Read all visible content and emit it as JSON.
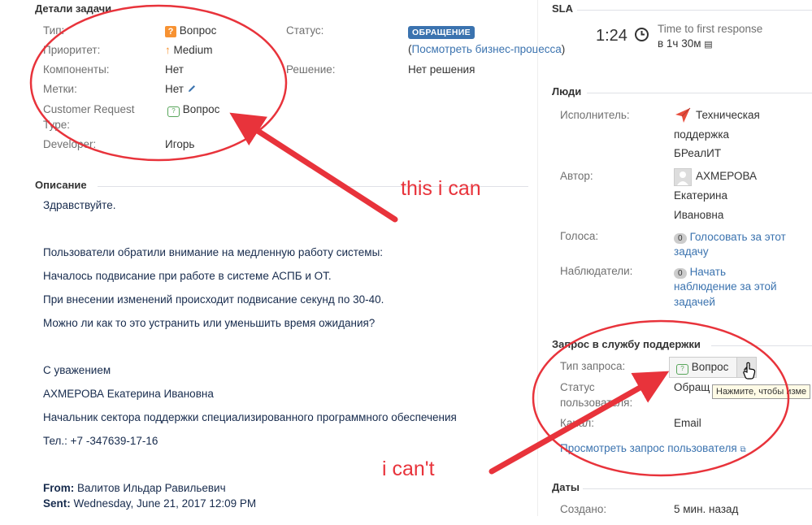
{
  "details": {
    "title": "Детали задачи",
    "type_label": "Тип:",
    "type_value": "Вопрос",
    "priority_label": "Приоритет:",
    "priority_value": "Medium",
    "components_label": "Компоненты:",
    "components_value": "Нет",
    "labels_label": "Метки:",
    "labels_value": "Нет",
    "crt_label_1": "Customer Request",
    "crt_label_2": "Type:",
    "crt_value": "Вопрос",
    "developer_label": "Developer:",
    "developer_value": "Игорь",
    "status_label": "Статус:",
    "status_value": "ОБРАЩЕНИЕ",
    "workflow_open": "(",
    "workflow_link": "Посмотреть бизнес-процесса",
    "workflow_close": ")",
    "resolution_label": "Решение:",
    "resolution_value": "Нет решения"
  },
  "description": {
    "title": "Описание",
    "lines": [
      "Здравствуйте.",
      "Пользователи обратили внимание на медленную работу системы:",
      "Началось подвисание при работе в системе АСПБ и ОТ.",
      "При внесении изменений происходит подвисание секунд по 30-40.",
      "Можно ли как то это устранить или уменьшить время ожидания?",
      "С уважением",
      "АХМЕРОВА Екатерина Ивановна",
      "Начальник сектора поддержки специализированного программного обеспечения",
      "Тел.: +7 -347639-17-16"
    ],
    "from_label": "From:",
    "from_value": "Валитов Ильдар Равильевич",
    "sent_label": "Sent:",
    "sent_value": "Wednesday, June 21, 2017 12:09 PM"
  },
  "sla": {
    "title": "SLA",
    "time": "1:24",
    "metric": "Time to first response",
    "target": "в 1ч 30м"
  },
  "people": {
    "title": "Люди",
    "assignee_label": "Исполнитель:",
    "assignee_lines": [
      "Техническая",
      "поддержка",
      "БРеалИТ"
    ],
    "reporter_label": "Автор:",
    "reporter_lines": [
      "АХМЕРОВА",
      "Екатерина",
      "Ивановна"
    ],
    "votes_label": "Голоса:",
    "votes_count": "0",
    "votes_link_lines": [
      "Голосовать за этот",
      "задачу"
    ],
    "watchers_label": "Наблюдатели:",
    "watchers_count": "0",
    "watchers_link_lines": [
      "Начать",
      "наблюдение за этой",
      "задачей"
    ]
  },
  "service_request": {
    "title": "Запрос в службу поддержки",
    "type_label": "Тип запроса:",
    "type_value": "Вопрос",
    "status_label_1": "Статус",
    "status_label_2": "пользователя:",
    "status_value": "Обращ",
    "channel_label": "Канал:",
    "channel_value": "Email",
    "view_link": "Просмотреть запрос пользователя",
    "tooltip": "Нажмите, чтобы изме"
  },
  "dates": {
    "title": "Даты",
    "created_label": "Создано:",
    "created_value": "5 мин. назад"
  },
  "annotations": {
    "top": "this i can",
    "bottom": "i can't",
    "color": "#e8333b"
  }
}
